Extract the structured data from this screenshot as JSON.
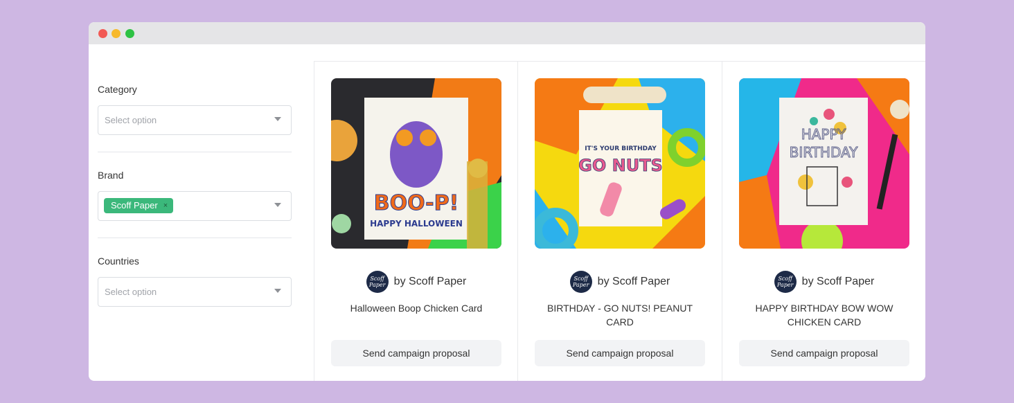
{
  "filters": {
    "category": {
      "label": "Category",
      "placeholder": "Select option"
    },
    "brand": {
      "label": "Brand",
      "selected_tag": "Scoff Paper",
      "remove_glyph": "×"
    },
    "countries": {
      "label": "Countries",
      "placeholder": "Select option"
    }
  },
  "products": [
    {
      "brand": "by Scoff Paper",
      "title": "Halloween Boop Chicken Card",
      "button": "Send campaign proposal",
      "image_icon": "halloween-card-image",
      "card_text_1": "BOO-P!",
      "card_text_2": "HAPPY HALLOWEEN"
    },
    {
      "brand": "by Scoff Paper",
      "title": "BIRTHDAY - GO NUTS! PEANUT CARD",
      "button": "Send campaign proposal",
      "image_icon": "birthday-nuts-card-image",
      "card_text_1": "IT'S YOUR BIRTHDAY",
      "card_text_2": "GO NUTS"
    },
    {
      "brand": "by Scoff Paper",
      "title": "HAPPY BIRTHDAY BOW WOW CHICKEN CARD",
      "button": "Send campaign proposal",
      "image_icon": "birthday-bowwow-card-image",
      "card_text_1": "HAPPY",
      "card_text_2": "BIRTHDAY"
    }
  ],
  "logo_text": "Scoff Paper",
  "colors": {
    "background": "#ceb7e3",
    "tag": "#3bb87b",
    "button_bg": "#f2f3f5",
    "logo_bg": "#1d2a47"
  }
}
